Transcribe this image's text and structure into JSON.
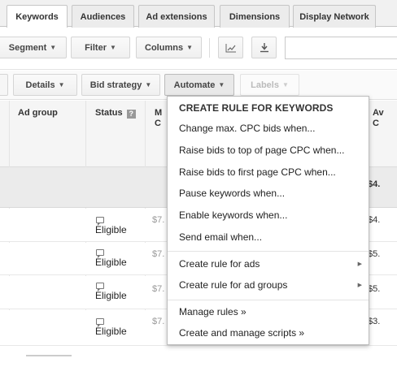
{
  "tabs": [
    {
      "label": "Keywords",
      "active": true
    },
    {
      "label": "Audiences",
      "active": false
    },
    {
      "label": "Ad extensions",
      "active": false
    },
    {
      "label": "Dimensions",
      "active": false
    },
    {
      "label": "Display Network",
      "active": false
    }
  ],
  "toolbar": {
    "segment": "Segment",
    "filter": "Filter",
    "columns": "Columns",
    "search_value": ""
  },
  "toolbar2": {
    "details": "Details",
    "bid_strategy": "Bid strategy",
    "automate": "Automate",
    "labels": "Labels"
  },
  "table": {
    "headers": {
      "ad_group": "Ad group",
      "status": "Status",
      "max_cpc_partial": "M",
      "max_cpc_partial2": "C",
      "avg_cpc_partial": "Av",
      "avg_cpc_partial2": "C"
    },
    "summary": {
      "avg_cpc": "$4."
    },
    "rows": [
      {
        "status": "Eligible",
        "max_cpc": "$7.",
        "avg_cpc": "$4."
      },
      {
        "status": "Eligible",
        "max_cpc": "$7.",
        "avg_cpc": "$5."
      },
      {
        "status": "Eligible",
        "max_cpc": "$7.",
        "avg_cpc": "$5."
      },
      {
        "status": "Eligible",
        "max_cpc": "$7.",
        "avg_cpc": "$3."
      }
    ]
  },
  "menu": {
    "header": "CREATE RULE FOR KEYWORDS",
    "items": [
      "Change max. CPC bids when...",
      "Raise bids to top of page CPC when...",
      "Raise bids to first page CPC when...",
      "Pause keywords when...",
      "Enable keywords when...",
      "Send email when..."
    ],
    "submenus": [
      "Create rule for ads",
      "Create rule for ad groups"
    ],
    "manage": [
      "Manage rules »",
      "Create and manage scripts »"
    ]
  },
  "colors": {
    "tab_bg": "#ececec",
    "active_tab_bg": "#ffffff",
    "summary_bg": "#ebebeb",
    "menu_border": "#bdbdbd"
  }
}
